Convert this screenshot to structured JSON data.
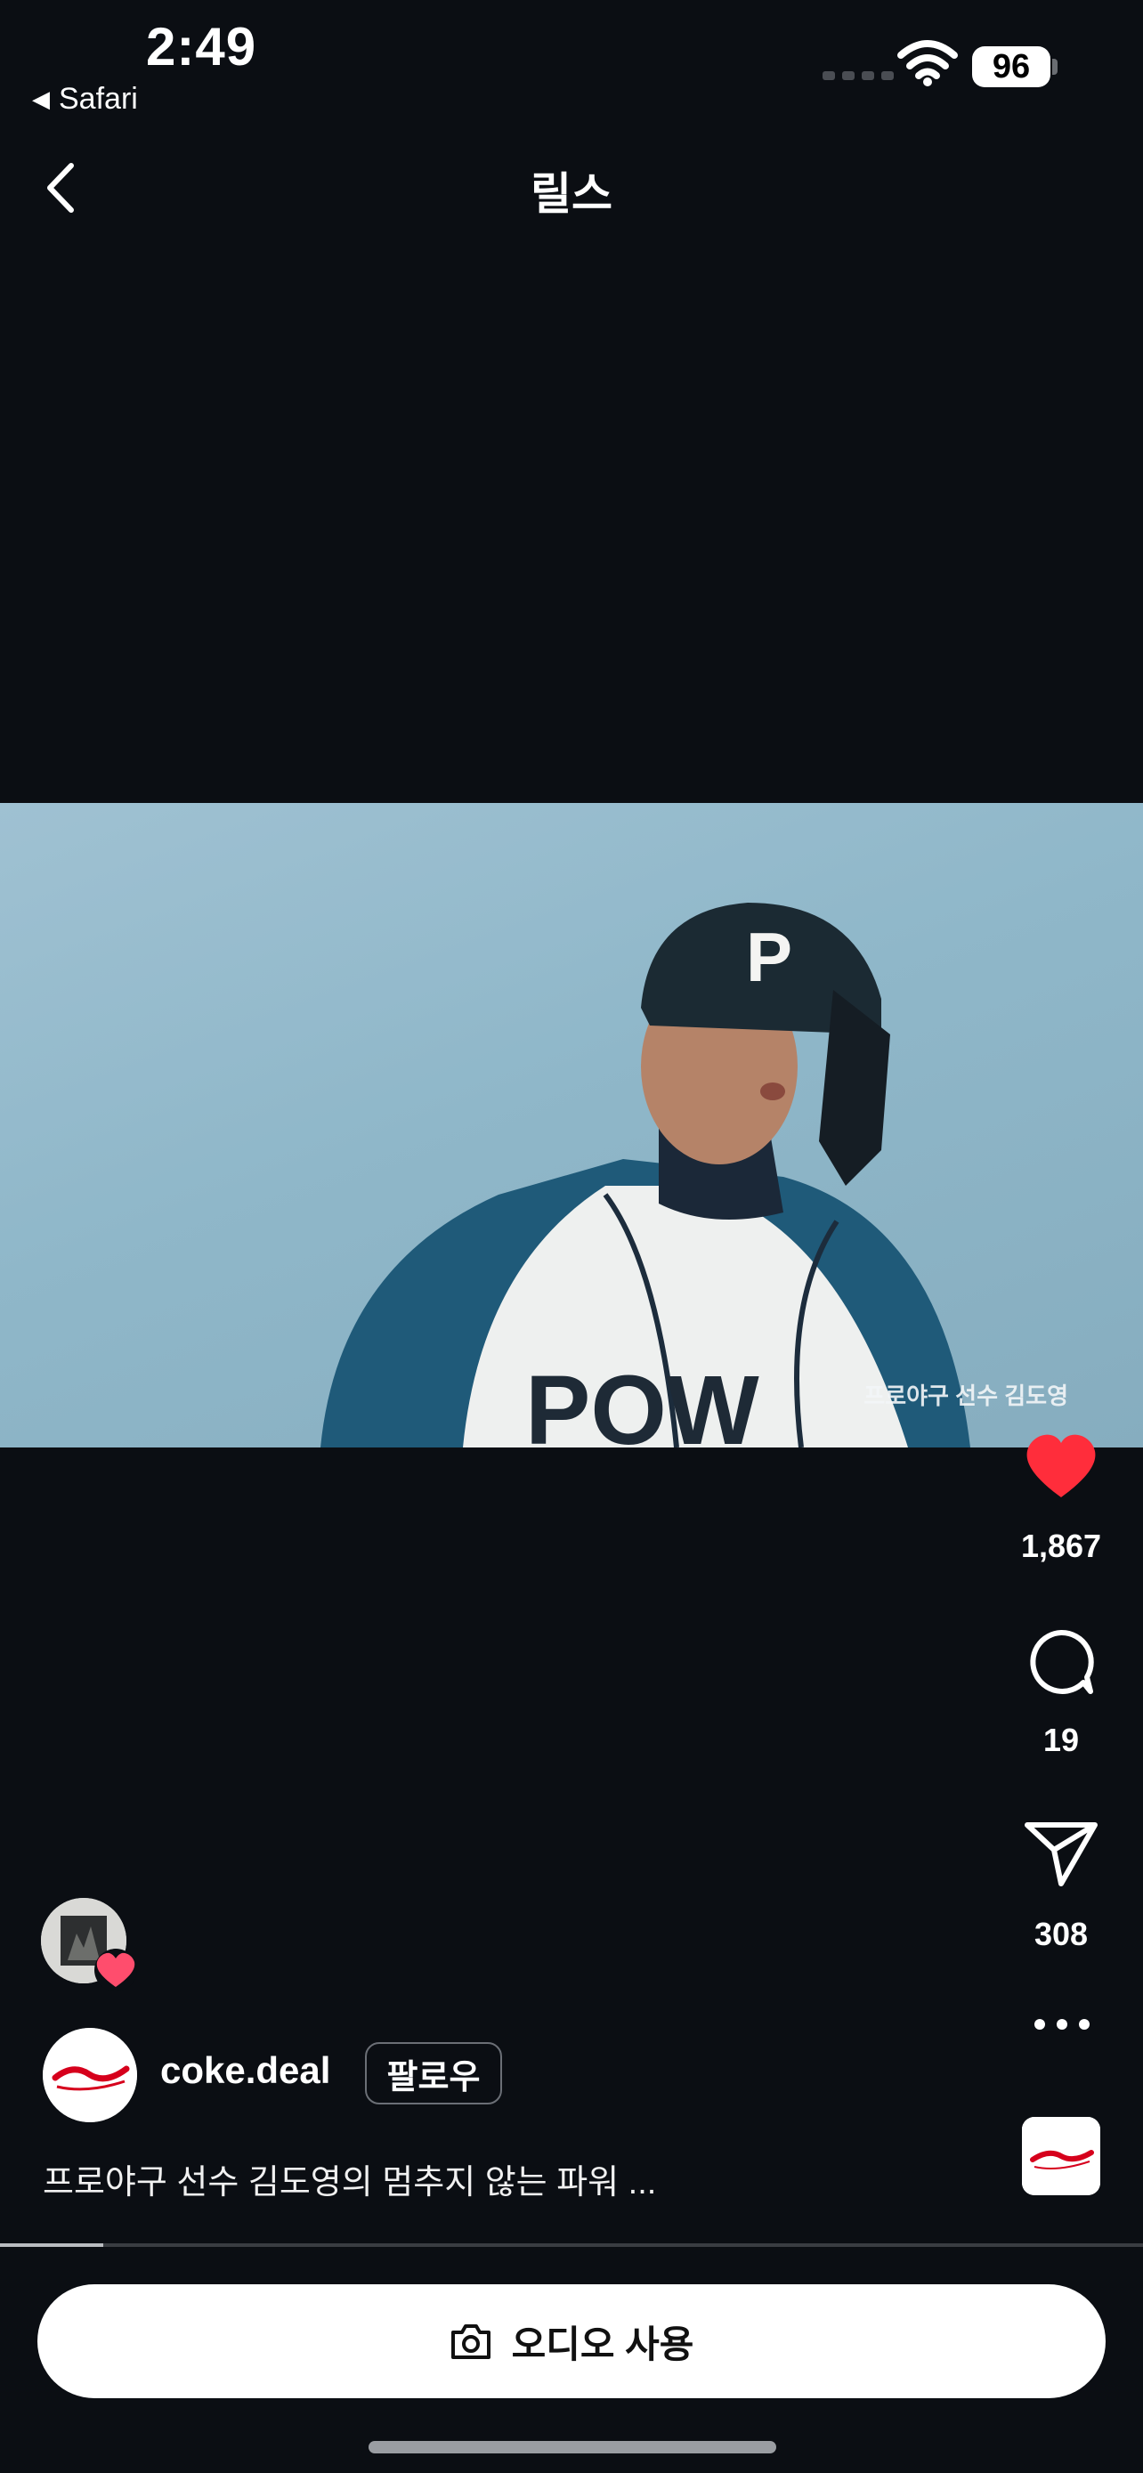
{
  "status_bar": {
    "time": "2:49",
    "back_app": "Safari",
    "battery": "96"
  },
  "header": {
    "title": "릴스"
  },
  "video": {
    "overlay_caption": "프로야구 선수 김도영"
  },
  "actions": {
    "likes": "1,867",
    "comments": "19",
    "shares": "308",
    "liked": true
  },
  "post": {
    "author": "coke.deal",
    "follow_label": "팔로우",
    "caption": "프로야구 선수 김도영의 멈추지 않는 파워 ...",
    "progress": 0.09
  },
  "bottom": {
    "use_audio_label": "오디오 사용"
  },
  "colors": {
    "background": "#0b0e13",
    "like_red": "#ff2d3b",
    "coke_red": "#d6001c"
  }
}
